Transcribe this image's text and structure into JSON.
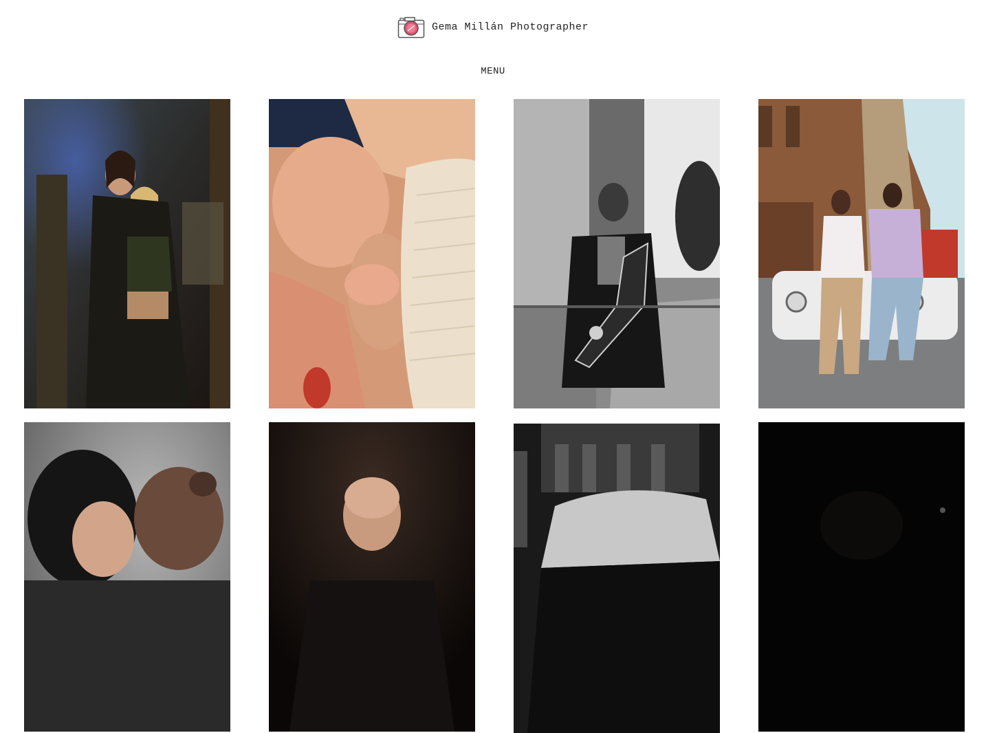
{
  "site": {
    "title": "Gema Millán Photographer",
    "logo_icon": "camera-icon",
    "accent_color": "#e8526f"
  },
  "nav": {
    "menu_label": "MENU"
  },
  "gallery": {
    "photos": [
      {
        "subject": "two-women-portrait"
      },
      {
        "subject": "newborn-breastfeeding"
      },
      {
        "subject": "saxophone-player-bw"
      },
      {
        "subject": "couple-with-vintage-car"
      },
      {
        "subject": "mother-child-embrace"
      },
      {
        "subject": "elderly-man-portrait"
      },
      {
        "subject": "bedroom-interior-bw"
      },
      {
        "subject": "dark-photo"
      }
    ]
  }
}
